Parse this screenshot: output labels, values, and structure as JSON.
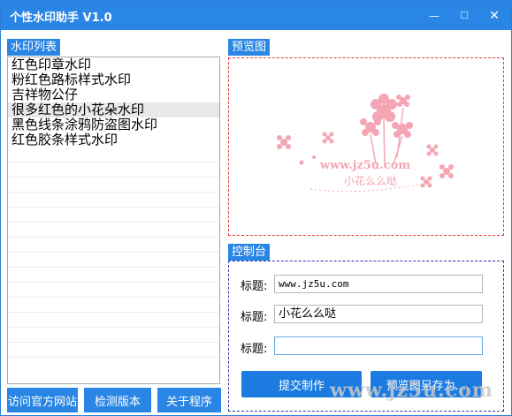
{
  "window": {
    "title": "个性水印助手 V1.0",
    "minimize_glyph": "—",
    "maximize_glyph": "☐",
    "close_glyph": "✕"
  },
  "watermark_list": {
    "label": "水印列表",
    "items": [
      "红色印章水印",
      "粉红色路标样式水印",
      "吉祥物公仔",
      "很多红色的小花朵水印",
      "黑色线条涂鸦防盗图水印",
      "红色胶条样式水印"
    ],
    "selected_index": 3
  },
  "bottom_buttons": {
    "visit_site": "访问官方网站",
    "check_version": "检测版本",
    "about": "关于程序"
  },
  "preview": {
    "label": "预览图",
    "image_text_line1": "www.jz5u.com",
    "image_text_line2": "小花么么哒"
  },
  "console": {
    "label": "控制台",
    "fields": [
      {
        "label": "标题:",
        "value": "www.jz5u.com"
      },
      {
        "label": "标题:",
        "value": "小花么么哒"
      },
      {
        "label": "标题:",
        "value": ""
      }
    ],
    "submit_button": "提交制作",
    "save_preview_button": "预览图另存为..."
  },
  "corner_watermark": "www.jz5u.com",
  "colors": {
    "accent": "#2a86e4",
    "button_blue": "#1c7be0",
    "preview_border": "#e03a3a",
    "console_border": "#2a3aa8",
    "flower_pink": "#f4a6b4"
  }
}
